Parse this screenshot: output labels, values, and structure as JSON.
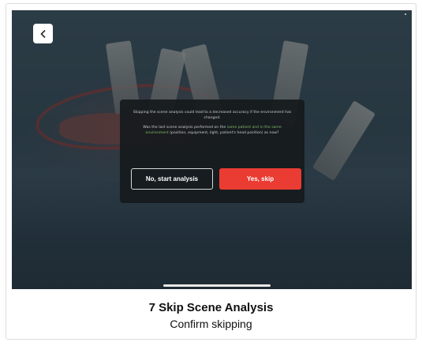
{
  "dialog": {
    "warning_text": "Skipping the scene analysis could lead to a decreased accuracy if the environment has changed.",
    "question_prefix": "Was the last scene analysis performed on the ",
    "question_highlight": "same patient and in the same environment",
    "question_suffix": " (position, equipment, light, patient's head position) as now?",
    "no_button_label": "No, start analysis",
    "yes_button_label": "Yes, skip"
  },
  "caption": {
    "title": "7 Skip Scene Analysis",
    "subtitle": "Confirm skipping"
  },
  "icons": {
    "back": "chevron-left-icon"
  },
  "colors": {
    "accent_red": "#ea3c33",
    "highlight_green": "#7fb86a",
    "dialog_bg": "#16191d"
  }
}
